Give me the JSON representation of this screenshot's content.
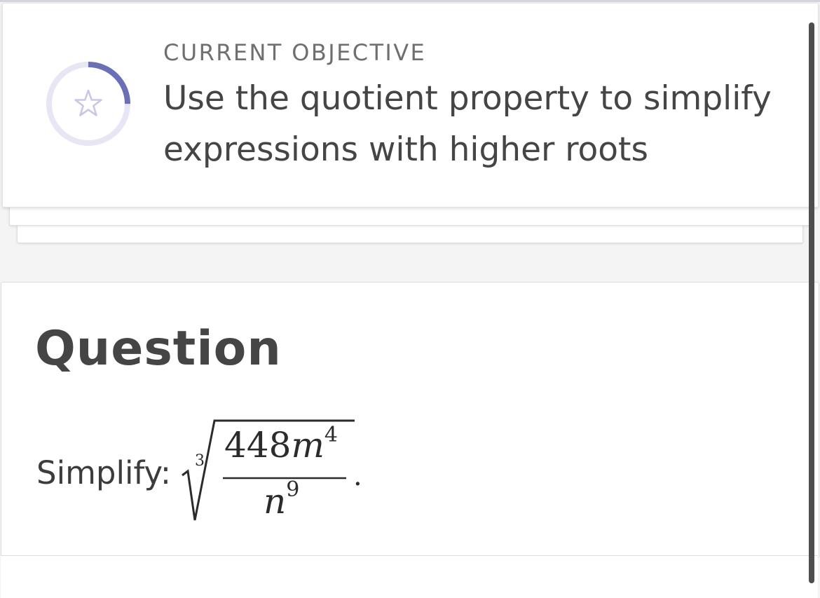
{
  "objective": {
    "label": "CURRENT OBJECTIVE",
    "text": "Use the quotient property to simplify expressions with higher roots",
    "progress_fraction": 0.25,
    "icon": "star-icon",
    "ring_color": "#6b6fb6",
    "ring_track_color": "#e6e6f4"
  },
  "question": {
    "heading": "Question",
    "prompt": "Simplify:",
    "expression": {
      "root_index": "3",
      "numerator_coef": "448",
      "numerator_var": "m",
      "numerator_exp": "4",
      "denominator_var": "n",
      "denominator_exp": "9",
      "trailing": "."
    }
  }
}
